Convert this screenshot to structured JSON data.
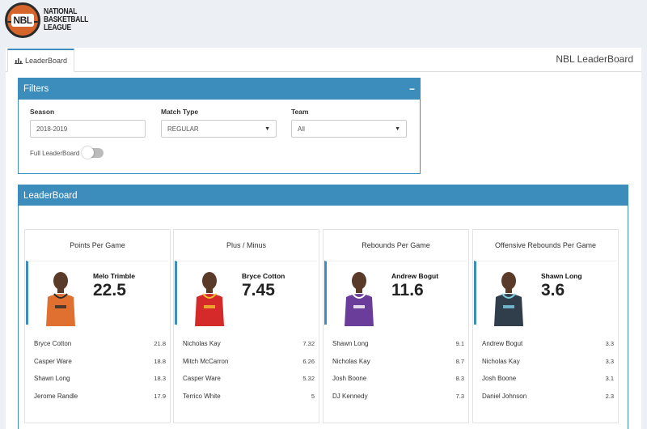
{
  "brand": {
    "logo_badge": "NBL",
    "logo_lines": [
      "NATIONAL",
      "BASKETBALL",
      "LEAGUE"
    ]
  },
  "tabs": [
    {
      "label": "LeaderBoard",
      "icon": "bar-chart-icon"
    }
  ],
  "page_title": "NBL LeaderBoard",
  "filters": {
    "title": "Filters",
    "collapse_label": "−",
    "season": {
      "label": "Season",
      "value": "2018-2019"
    },
    "match_type": {
      "label": "Match Type",
      "value": "REGULAR"
    },
    "team": {
      "label": "Team",
      "value": "All"
    },
    "full_leaderboard": {
      "label": "Full LeaderBoard",
      "enabled": false
    }
  },
  "leaderboard": {
    "title": "LeaderBoard",
    "cards": [
      {
        "title": "Points Per Game",
        "leader": {
          "name": "Melo Trimble",
          "value": "22.5",
          "jersey_color": "#e07030",
          "jersey_accent": "#2c2c2c"
        },
        "others": [
          {
            "name": "Bryce Cotton",
            "value": "21.8"
          },
          {
            "name": "Casper Ware",
            "value": "18.8"
          },
          {
            "name": "Shawn Long",
            "value": "18.3"
          },
          {
            "name": "Jerome Randle",
            "value": "17.9"
          }
        ]
      },
      {
        "title": "Plus / Minus",
        "leader": {
          "name": "Bryce Cotton",
          "value": "7.45",
          "jersey_color": "#d42a2a",
          "jersey_accent": "#f2c230"
        },
        "others": [
          {
            "name": "Nicholas Kay",
            "value": "7.32"
          },
          {
            "name": "Mitch McCarron",
            "value": "6.26"
          },
          {
            "name": "Casper Ware",
            "value": "5.32"
          },
          {
            "name": "Terrico White",
            "value": "5"
          }
        ]
      },
      {
        "title": "Rebounds Per Game",
        "leader": {
          "name": "Andrew Bogut",
          "value": "11.6",
          "jersey_color": "#6a3d9a",
          "jersey_accent": "#ffffff"
        },
        "others": [
          {
            "name": "Shawn Long",
            "value": "9.1"
          },
          {
            "name": "Nicholas Kay",
            "value": "8.7"
          },
          {
            "name": "Josh Boone",
            "value": "8.3"
          },
          {
            "name": "DJ Kennedy",
            "value": "7.3"
          }
        ]
      },
      {
        "title": "Offensive Rebounds Per Game",
        "leader": {
          "name": "Shawn Long",
          "value": "3.6",
          "jersey_color": "#2f3e4a",
          "jersey_accent": "#7fd0e6"
        },
        "others": [
          {
            "name": "Andrew Bogut",
            "value": "3.3"
          },
          {
            "name": "Nicholas Kay",
            "value": "3.3"
          },
          {
            "name": "Josh Boone",
            "value": "3.1"
          },
          {
            "name": "Daniel Johnson",
            "value": "2.3"
          }
        ]
      }
    ]
  }
}
